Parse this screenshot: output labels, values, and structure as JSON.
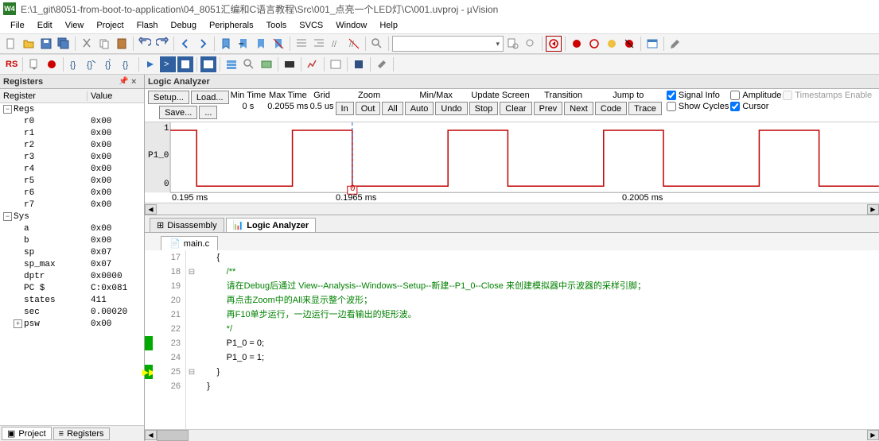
{
  "app_icon": "W4",
  "title": "E:\\1_git\\8051-from-boot-to-application\\04_8051汇编和C语言教程\\Src\\001_点亮一个LED灯\\C\\001.uvproj - µVision",
  "menu": [
    "File",
    "Edit",
    "View",
    "Project",
    "Flash",
    "Debug",
    "Peripherals",
    "Tools",
    "SVCS",
    "Window",
    "Help"
  ],
  "registers_title": "Registers",
  "reg_head": {
    "c1": "Register",
    "c2": "Value"
  },
  "regs_group": "Regs",
  "sys_group": "Sys",
  "regs": [
    {
      "n": "r0",
      "v": "0x00"
    },
    {
      "n": "r1",
      "v": "0x00"
    },
    {
      "n": "r2",
      "v": "0x00"
    },
    {
      "n": "r3",
      "v": "0x00"
    },
    {
      "n": "r4",
      "v": "0x00"
    },
    {
      "n": "r5",
      "v": "0x00"
    },
    {
      "n": "r6",
      "v": "0x00"
    },
    {
      "n": "r7",
      "v": "0x00"
    }
  ],
  "sys": [
    {
      "n": "a",
      "v": "0x00"
    },
    {
      "n": "b",
      "v": "0x00"
    },
    {
      "n": "sp",
      "v": "0x07"
    },
    {
      "n": "sp_max",
      "v": "0x07"
    },
    {
      "n": "dptr",
      "v": "0x0000"
    },
    {
      "n": "PC  $",
      "v": "C:0x081"
    },
    {
      "n": "states",
      "v": "411"
    },
    {
      "n": "sec",
      "v": "0.00020"
    },
    {
      "n": "psw",
      "v": "0x00",
      "exp": true
    }
  ],
  "bottom_tabs": {
    "project": "Project",
    "registers": "Registers"
  },
  "la_title": "Logic Analyzer",
  "la": {
    "setup": "Setup...",
    "load": "Load...",
    "save": "Save...",
    "export": "...",
    "min_time": "Min Time",
    "min_time_v": "0 s",
    "max_time": "Max Time",
    "max_time_v": "0.2055 ms",
    "grid": "Grid",
    "grid_v": "0.5 us",
    "zoom": "Zoom",
    "in": "In",
    "out": "Out",
    "all": "All",
    "minmax": "Min/Max",
    "auto": "Auto",
    "undo": "Undo",
    "update": "Update Screen",
    "stop": "Stop",
    "clear": "Clear",
    "transition": "Transition",
    "prev": "Prev",
    "next": "Next",
    "jump": "Jump to",
    "code": "Code",
    "trace": "Trace",
    "signal_info": "Signal Info",
    "amplitude": "Amplitude",
    "timestamps": "Timestamps Enable",
    "show_cycles": "Show Cycles",
    "cursor": "Cursor"
  },
  "wave": {
    "signal": "P1_0",
    "y0": "0",
    "y1": "1",
    "cursor_val": "0",
    "t1": "0.195 ms",
    "t2": "0.1965 ms",
    "t3": "0.2005 ms"
  },
  "tabs2": {
    "disassembly": "Disassembly",
    "la": "Logic Analyzer"
  },
  "file_tab": "main.c",
  "code_lines": [
    {
      "n": 17,
      "t": "        {"
    },
    {
      "n": 18,
      "t": "            /**",
      "c": true,
      "fold": "-"
    },
    {
      "n": 19,
      "t": "            请在Debug后通过 View--Analysis--Windows--Setup--新建--P1_0--Close 来创建模拟器中示波器的采样引脚；",
      "c": true
    },
    {
      "n": 20,
      "t": "            再点击Zoom中的All来显示整个波形；",
      "c": true
    },
    {
      "n": 21,
      "t": "            再F10单步运行，一边运行一边看输出的矩形波。",
      "c": true
    },
    {
      "n": 22,
      "t": "            */",
      "c": true
    },
    {
      "n": 23,
      "t": "            P1_0 = 0;",
      "brk": "g"
    },
    {
      "n": 24,
      "t": "            P1_0 = 1;"
    },
    {
      "n": 25,
      "t": "        }",
      "brk": "arrow",
      "fold": "-"
    },
    {
      "n": 26,
      "t": "    }"
    }
  ]
}
